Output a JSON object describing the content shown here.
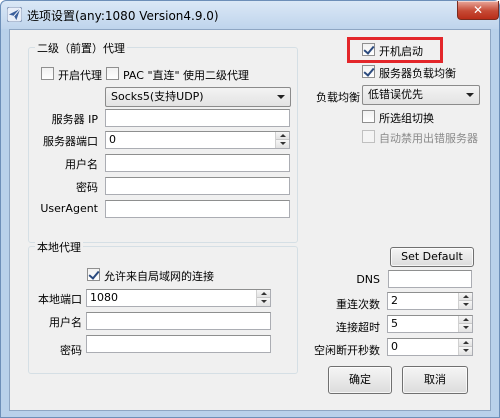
{
  "window": {
    "title": "选项设置(any:1080 Version4.9.0)",
    "close_glyph": "✕"
  },
  "secondary_proxy": {
    "group_title": "二级（前置）代理",
    "enable_label": "开启代理",
    "enable_checked": false,
    "pac_label": "PAC \"直连\" 使用二级代理",
    "pac_checked": false,
    "protocol_selected": "Socks5(支持UDP)",
    "server_ip_label": "服务器 IP",
    "server_ip_value": "",
    "server_port_label": "服务器端口",
    "server_port_value": "0",
    "username_label": "用户名",
    "username_value": "",
    "password_label": "密码",
    "password_value": "",
    "useragent_label": "UserAgent",
    "useragent_value": ""
  },
  "local_proxy": {
    "group_title": "本地代理",
    "allow_lan_label": "允许来自局域网的连接",
    "allow_lan_checked": true,
    "local_port_label": "本地端口",
    "local_port_value": "1080",
    "username_label": "用户名",
    "username_value": "",
    "password_label": "密码",
    "password_value": ""
  },
  "options": {
    "autostart_label": "开机启动",
    "autostart_checked": true,
    "load_balance_label": "服务器负载均衡",
    "load_balance_checked": true,
    "balance_mode_label": "负载均衡",
    "balance_mode_selected": "低错误优先",
    "group_switch_label": "所选组切换",
    "group_switch_checked": false,
    "auto_disable_label": "自动禁用出错服务器",
    "auto_disable_checked": false,
    "auto_disable_enabled": false
  },
  "advanced": {
    "set_default_label": "Set Default",
    "dns_label": "DNS",
    "dns_value": "",
    "retry_label": "重连次数",
    "retry_value": "2",
    "timeout_label": "连接超时",
    "timeout_value": "5",
    "idle_label": "空闲断开秒数",
    "idle_value": "0"
  },
  "buttons": {
    "ok_label": "确定",
    "cancel_label": "取消"
  },
  "colors": {
    "highlight": "#e3262a",
    "titlebar": "#bfd4ec",
    "close_button": "#c64a35"
  }
}
